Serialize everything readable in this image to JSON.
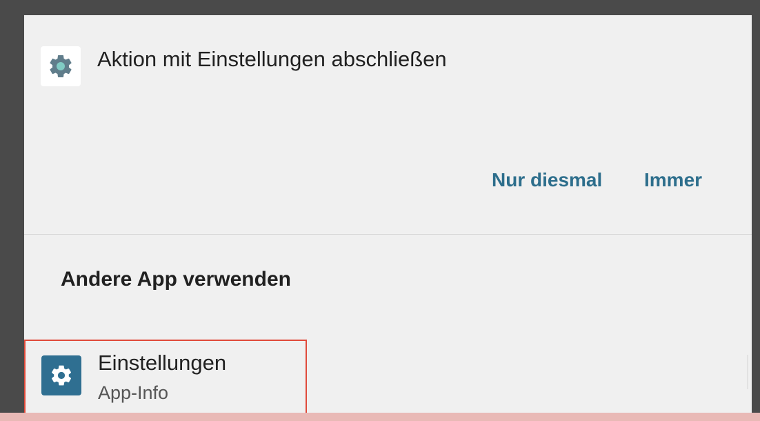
{
  "dialog": {
    "title": "Aktion mit Einstellungen abschließen",
    "header_icon": "gear-icon",
    "buttons": {
      "once_label": "Nur diesmal",
      "always_label": "Immer"
    },
    "other_apps_label": "Andere App verwenden",
    "apps": [
      {
        "name": "Einstellungen",
        "subtitle": "App-Info",
        "icon": "gear-icon"
      }
    ]
  },
  "colors": {
    "accent": "#2d6e8c",
    "app_icon_bg": "#2f6f91",
    "highlight_border": "#e04a3a",
    "sheet_bg": "#f0f0f0",
    "backdrop": "#4a4a4a"
  }
}
